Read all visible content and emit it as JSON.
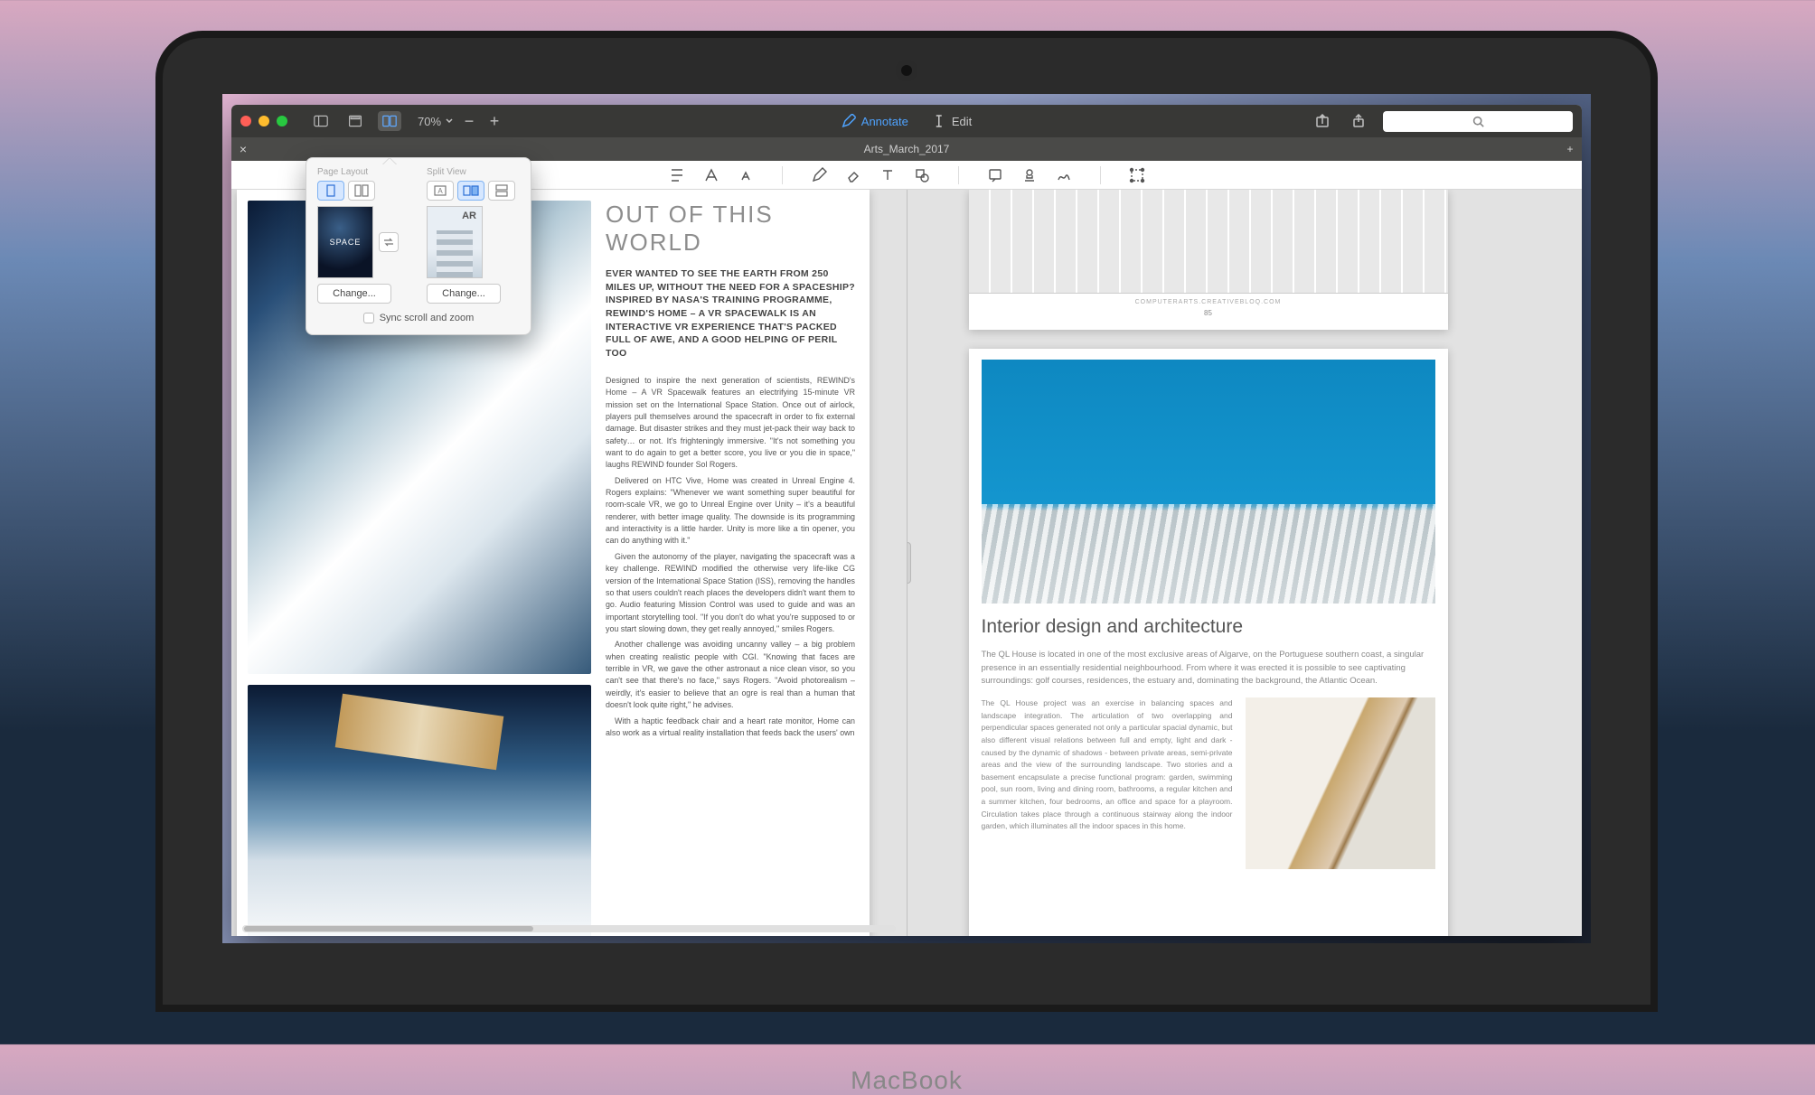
{
  "laptop_label": "MacBook",
  "titlebar": {
    "zoom_value": "70%",
    "mode_annotate": "Annotate",
    "mode_edit": "Edit"
  },
  "tabbar": {
    "close_glyph": "×",
    "title": "Arts_March_2017",
    "add_glyph": "+"
  },
  "popover": {
    "page_layout_h": "Page Layout",
    "split_view_h": "Split View",
    "thumb_left_label": "SPACE",
    "thumb_right_label": "AR",
    "change_btn": "Change...",
    "sync_label": "Sync scroll and zoom"
  },
  "left_doc": {
    "title": "OUT OF THIS WORLD",
    "lead": "EVER WANTED TO SEE THE EARTH FROM 250 MILES UP, WITHOUT THE NEED FOR A SPACESHIP? INSPIRED BY NASA'S TRAINING PROGRAMME, REWIND'S HOME – A VR SPACEWALK IS AN INTERACTIVE VR EXPERIENCE THAT'S PACKED FULL OF AWE, AND A GOOD HELPING OF PERIL TOO",
    "p1": "Designed to inspire the next generation of scientists, REWIND's Home – A VR Spacewalk features an electrifying 15-minute VR mission set on the International Space Station. Once out of airlock, players pull themselves around the spacecraft in order to fix external damage. But disaster strikes and they must jet-pack their way back to safety… or not. It's frighteningly immersive. \"It's not something you want to do again to get a better score, you live or you die in space,\" laughs REWIND founder Sol Rogers.",
    "p2": "Delivered on HTC Vive, Home was created in Unreal Engine 4. Rogers explains: \"Whenever we want something super beautiful for room-scale VR, we go to Unreal Engine over Unity – it's a beautiful renderer, with better image quality. The downside is its programming and interactivity is a little harder. Unity is more like a tin opener, you can do anything with it.\"",
    "p3": "Given the autonomy of the player, navigating the spacecraft was a key challenge. REWIND modified the otherwise very life-like CG version of the International Space Station (ISS), removing the handles so that users couldn't reach places the developers didn't want them to go. Audio featuring Mission Control was used to guide and was an important storytelling tool. \"If you don't do what you're supposed to or you start slowing down, they get really annoyed,\" smiles Rogers.",
    "p4": "Another challenge was avoiding uncanny valley – a big problem when creating realistic people with CGI. \"Knowing that faces are terrible in VR, we gave the other astronaut a nice clean visor, so you can't see that there's no face,\" says Rogers. \"Avoid photorealism – weirdly, it's easier to believe that an ogre is real than a human that doesn't look quite right,\" he advises.",
    "p5": "With a haptic feedback chair and a heart rate monitor, Home can also work as a virtual reality installation that feeds back the users' own"
  },
  "right_top": {
    "caption": "COMPUTERARTS.CREATIVEBLOQ.COM",
    "page_no": "85"
  },
  "right_main": {
    "title": "Interior design and architecture",
    "lead": "The QL House is located in one of the most exclusive areas of Algarve, on the Portuguese southern coast, a singular presence in an essentially residential neighbourhood. From where it was erected it is possible to see captivating surroundings: golf courses, residences, the estuary and, dominating the background, the Atlantic Ocean.",
    "body": "The QL House project was an exercise in balancing spaces and landscape integration. The articulation of two overlapping and perpendicular spaces generated not only a particular spacial dynamic, but also different visual relations between full and empty, light and dark - caused by the dynamic of shadows - between private areas, semi-private areas and the view of the surrounding landscape.\nTwo stories and a basement encapsulate a precise functional program: garden, swimming pool, sun room, living and dining room, bathrooms, a regular kitchen and a summer kitchen, four bedrooms, an office and space for a playroom. Circulation takes place through a continuous stairway along the indoor garden, which illuminates all the indoor spaces in this home."
  }
}
